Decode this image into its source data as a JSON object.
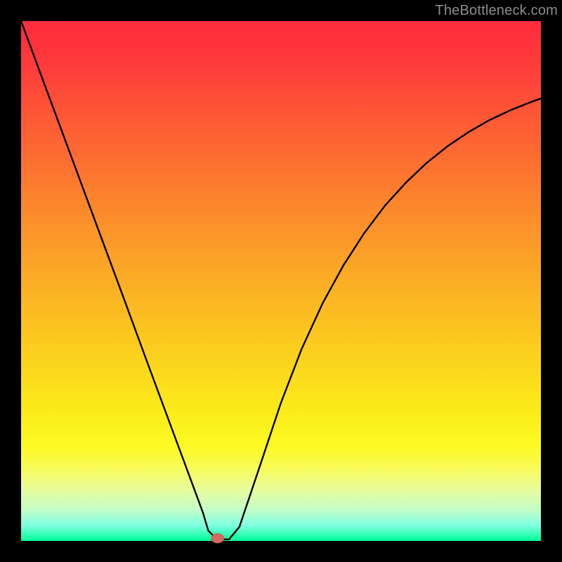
{
  "watermark": {
    "text": "TheBottleneck.com"
  },
  "colors": {
    "curve_stroke": "#000000",
    "marker_fill": "#d46a5f",
    "marker_stroke": "#c25a50",
    "background": "#000000"
  },
  "chart_data": {
    "type": "line",
    "title": "",
    "xlabel": "",
    "ylabel": "",
    "xlim": [
      0,
      100
    ],
    "ylim": [
      0,
      100
    ],
    "grid": false,
    "legend": false,
    "x": [
      0,
      4,
      8,
      12,
      16,
      20,
      24,
      28,
      30,
      32,
      33,
      34,
      35,
      36,
      37,
      38,
      40,
      42,
      46,
      50,
      54,
      58,
      62,
      66,
      70,
      74,
      78,
      82,
      86,
      90,
      94,
      98,
      100
    ],
    "y": [
      100,
      89.2,
      78.4,
      67.6,
      56.8,
      46.0,
      35.1,
      24.3,
      18.9,
      13.5,
      10.8,
      8.1,
      5.4,
      2.0,
      1.0,
      0.3,
      0.3,
      2.7,
      14.6,
      26.6,
      37.0,
      45.7,
      53.0,
      59.2,
      64.5,
      68.9,
      72.7,
      75.9,
      78.6,
      80.9,
      82.8,
      84.4,
      85.1
    ],
    "marker": {
      "x": 37.8,
      "y": 0.5,
      "rx": 1.2,
      "ry": 0.9
    }
  }
}
